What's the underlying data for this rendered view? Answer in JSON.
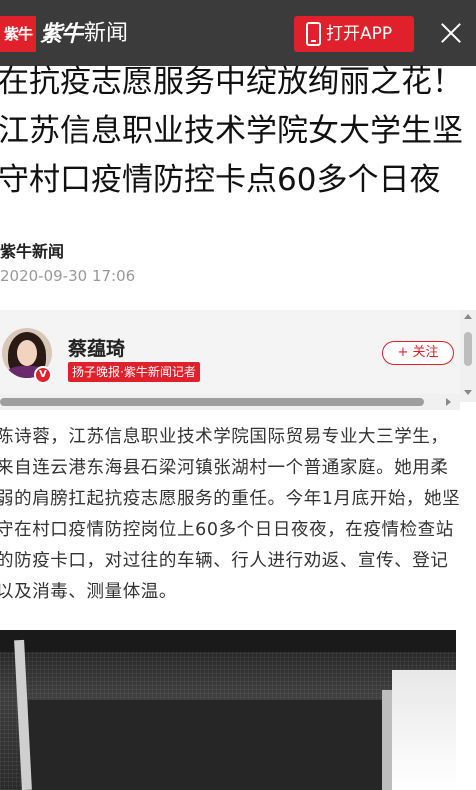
{
  "header": {
    "logo_badge": "紫牛",
    "logo_brush": "紫牛",
    "logo_news": "新闻",
    "open_app_label": "打开APP",
    "colors": {
      "bar": "#3b3b3b",
      "brand_red": "#e0202a"
    }
  },
  "article": {
    "title": "在抗疫志愿服务中绽放绚丽之花！江苏信息职业技术学院女大学生坚守村口疫情防控卡点60多个日夜",
    "source": "紫牛新闻",
    "date": "2020-09-30 17:06"
  },
  "author": {
    "name": "蔡蕴琦",
    "tag": "扬子晚报·紫牛新闻记者",
    "verified_mark": "V",
    "follow_label": "+ 关注"
  },
  "body": {
    "paragraph": "陈诗蓉，江苏信息职业技术学院国际贸易专业大三学生，来自连云港东海县石梁河镇张湖村一个普通家庭。她用柔弱的肩膀扛起抗疫志愿服务的重任。今年1月底开始，她坚守在村口疫情防控岗位上60多个日日夜夜，在疫情检查站的防疫卡口，对过往的车辆、行人进行劝返、宣传、登记以及消毒、测量体温。"
  }
}
